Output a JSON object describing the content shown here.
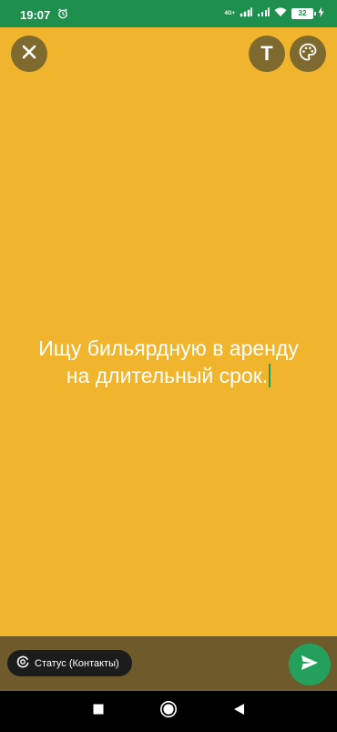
{
  "status_bar": {
    "time": "19:07",
    "network": "4G+",
    "battery": "32"
  },
  "top_controls": {
    "text_tool_label": "T"
  },
  "status_text": {
    "line1": "Ищу бильярдную в аренду",
    "line2": "на длительный срок."
  },
  "bottom": {
    "audience_label": "Статус (Контакты)"
  },
  "colors": {
    "background": "#f0b42d",
    "status_bar": "#1f8f4d",
    "send_button": "#23a15c",
    "cursor": "#1aa160"
  },
  "icons": {
    "close": "close-icon",
    "palette": "palette-icon",
    "audience": "status-icon",
    "send": "send-icon",
    "nav_recents": "square-icon",
    "nav_home": "circle-icon",
    "nav_back": "triangle-back-icon"
  }
}
